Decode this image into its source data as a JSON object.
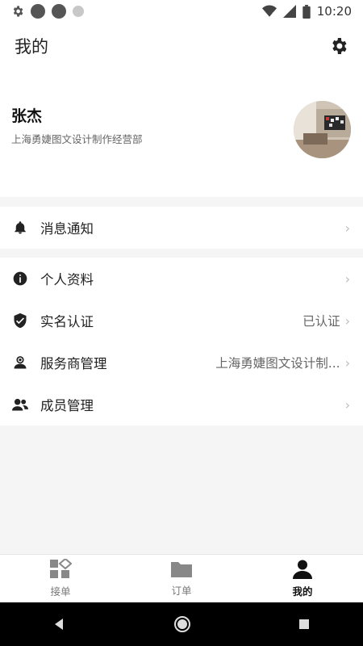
{
  "status_bar": {
    "time": "10:20"
  },
  "header": {
    "title": "我的"
  },
  "profile": {
    "name": "张杰",
    "company": "上海勇婕图文设计制作经营部"
  },
  "menu_group_1": [
    {
      "label": "消息通知",
      "icon": "bell-icon",
      "value": ""
    }
  ],
  "menu_group_2": [
    {
      "label": "个人资料",
      "icon": "info-icon",
      "value": ""
    },
    {
      "label": "实名认证",
      "icon": "shield-check-icon",
      "value": "已认证"
    },
    {
      "label": "服务商管理",
      "icon": "contact-person-icon",
      "value": "上海勇婕图文设计制..."
    },
    {
      "label": "成员管理",
      "icon": "group-icon",
      "value": ""
    }
  ],
  "bottom_nav": {
    "tabs": [
      {
        "label": "接单",
        "icon": "grid-apps-icon",
        "active": false
      },
      {
        "label": "订单",
        "icon": "folder-icon",
        "active": false
      },
      {
        "label": "我的",
        "icon": "person-icon",
        "active": true
      }
    ]
  },
  "colors": {
    "background": "#f5f5f5",
    "card": "#ffffff",
    "text": "#222222",
    "secondary_text": "#666666",
    "system_bar": "#000000"
  }
}
